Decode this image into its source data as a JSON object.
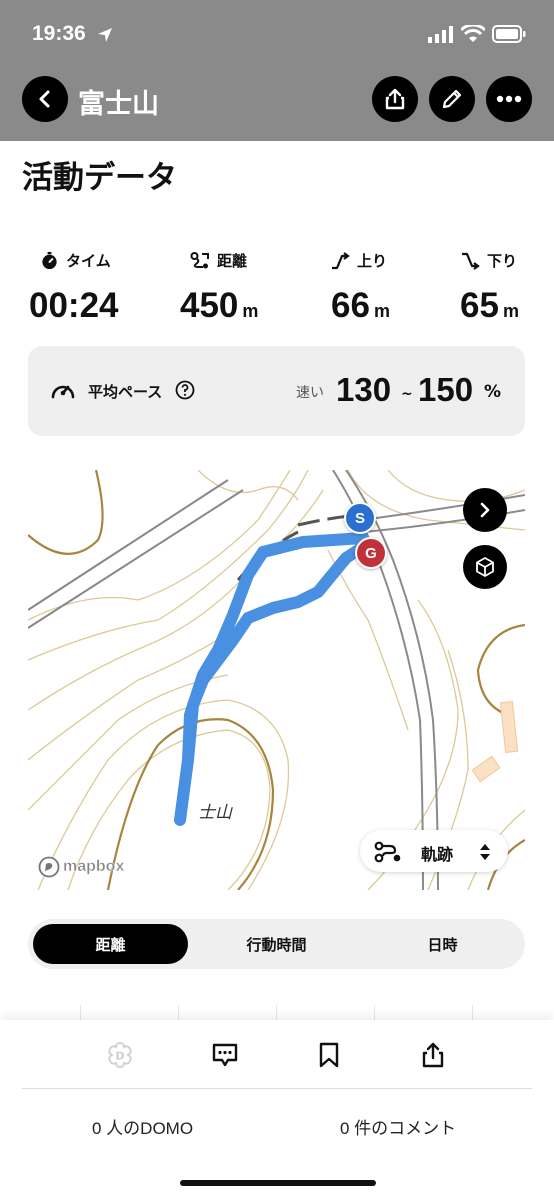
{
  "status_bar": {
    "time": "19:36"
  },
  "header": {
    "title": "富士山"
  },
  "section_title": "活動データ",
  "stats": [
    {
      "label": "タイム",
      "value": "00:24",
      "unit": "",
      "icon": "stopwatch-icon"
    },
    {
      "label": "距離",
      "value": "450",
      "unit": "m",
      "icon": "route-icon"
    },
    {
      "label": "上り",
      "value": "66",
      "unit": "m",
      "icon": "ascent-icon"
    },
    {
      "label": "下り",
      "value": "65",
      "unit": "m",
      "icon": "descent-icon"
    }
  ],
  "pace": {
    "label": "平均ペース",
    "speed_label": "速い",
    "low": "130",
    "separator": "~",
    "high": "150",
    "unit": "%"
  },
  "map": {
    "start_marker": "S",
    "goal_marker": "G",
    "place_label": "士山",
    "attribution": "mapbox",
    "track_button": "軌跡",
    "route_color": "#4a90e2",
    "contour_color": "#d8c89a"
  },
  "segments": {
    "items": [
      "距離",
      "行動時間",
      "日時"
    ],
    "active": 0
  },
  "bottom": {
    "domo_count": "0 人のDOMO",
    "comment_count": "0 件のコメント"
  }
}
